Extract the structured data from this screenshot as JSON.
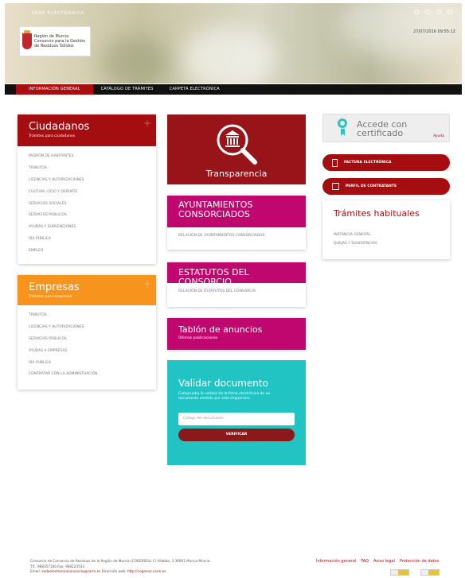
{
  "header": {
    "sede_label": "SEDE ELECTRÓNICA",
    "org_lines": [
      "Región de Murcia",
      "Consorcio para la Gestión",
      "de Residuos Sólidos"
    ],
    "datetime": "27/07/2016 09:55:12"
  },
  "nav": [
    "INFORMACIÓN GENERAL",
    "CATÁLOGO DE TRÁMITES",
    "CARPETA ELECTRÓNICA"
  ],
  "ciudadanos": {
    "title": "Ciudadanos",
    "subtitle": "Trámites para ciudadanos",
    "items": [
      "PADRÓN DE HABITANTES",
      "TRIBUTOS",
      "LICENCIAS Y AUTORIZACIONES",
      "CULTURA, OCIO Y DEPORTE",
      "SERVICIOS SOCIALES",
      "SERVICIOS PÚBLICOS",
      "AYUDAS Y SUBVENCIONES",
      "VÍA PÚBLICA",
      "EMPLEO"
    ]
  },
  "empresas": {
    "title": "Empresas",
    "subtitle": "Trámites para empresas",
    "items": [
      "TRIBUTOS",
      "LICENCIAS Y AUTORIZACIONES",
      "SERVICIOS PÚBLICOS",
      "AYUDAS A EMPRESAS",
      "VÍA PÚBLICA",
      "CONTRATAR CON LA ADMINISTRACIÓN"
    ]
  },
  "transparencia": {
    "label": "Transparencia"
  },
  "ayuntamientos": {
    "title": "AYUNTAMIENTOS CONSORCIADOS",
    "link": "RELACIÓN DE AYUNTAMIENTOS CONSORCIADOS"
  },
  "estatutos": {
    "title": "ESTATUTOS DEL CONSORCIO",
    "link": "RELACIÓN DE ESTATUTOS DEL CONSORCIO"
  },
  "tablon": {
    "title": "Tablón de anuncios",
    "subtitle": "Últimas publicaciones"
  },
  "validar": {
    "title": "Validar documento",
    "desc": "Comprueba la validez de la firma electrónica de un documento emitido por este Organismo",
    "placeholder": "Código del documento",
    "button": "VERIFICAR"
  },
  "certificado": {
    "line1": "Accede con",
    "line2": "certificado",
    "help": "Ayuda"
  },
  "pills": [
    "FACTURA ELECTRÓNICA",
    "PERFIL DE CONTRATANTE"
  ],
  "tramites": {
    "title": "Trámites habituales",
    "items": [
      "INSTANCIA GENERAL",
      "QUEJAS Y SUGERENCIAS"
    ]
  },
  "footer": {
    "address": "Consorcio de Consorcio de Residuos de la Región de Murcia (COGERSOL) C/ Villalba, 3 30001 Murcia Murcia",
    "phone": "Tlf.: 968357100 Fax: 968223533",
    "email_label": "Email:",
    "email": "sedeelectronicaconsorcio@carm.es",
    "web_label": "Dirección web:",
    "web": "http://cogersol.carm.es",
    "links": [
      "Información general",
      "FAQ",
      "Aviso legal",
      "Protección de datos"
    ]
  },
  "colors": {
    "red": "#a50e11",
    "orange": "#f7941d",
    "magenta": "#c0076f",
    "teal": "#1fc0c0"
  }
}
